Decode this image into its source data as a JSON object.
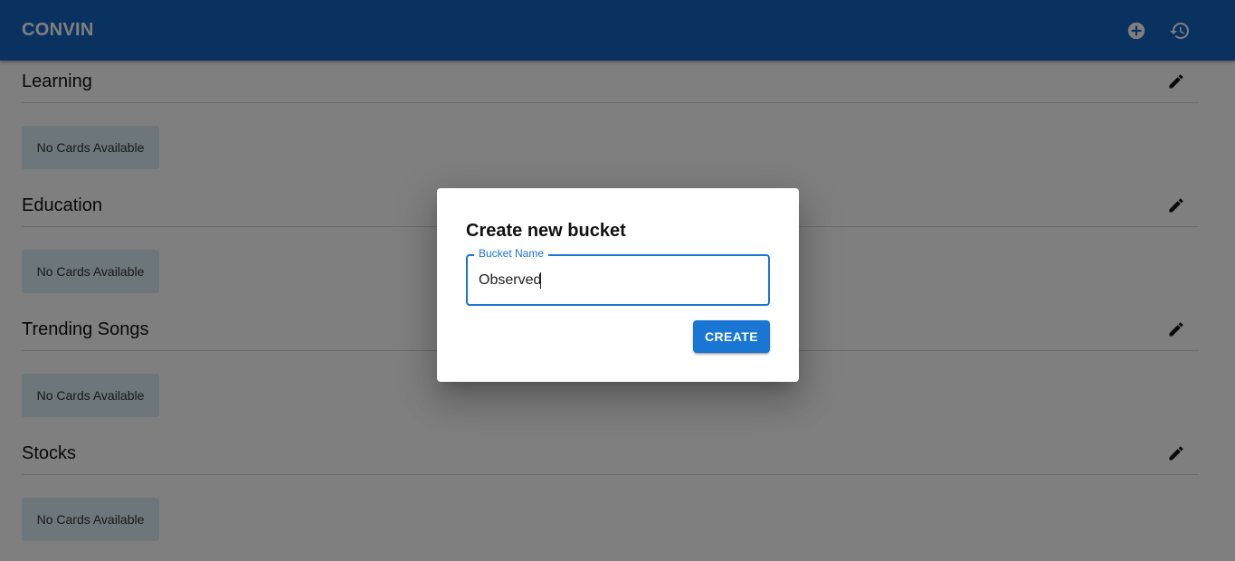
{
  "app": {
    "brand": "CONVIN",
    "actions": [
      {
        "icon": "add-circle-icon"
      },
      {
        "icon": "history-icon"
      }
    ]
  },
  "sections": [
    {
      "title": "Learning",
      "empty_text": "No Cards Available"
    },
    {
      "title": "Education",
      "empty_text": "No Cards Available"
    },
    {
      "title": "Trending Songs",
      "empty_text": "No Cards Available"
    },
    {
      "title": "Stocks",
      "empty_text": "No Cards Available"
    }
  ],
  "dialog": {
    "title": "Create new bucket",
    "field_label": "Bucket Name",
    "field_value": "Observed",
    "submit_label": "CREATE"
  },
  "colors": {
    "appbar": "#1565c0",
    "accent": "#1976d2",
    "empty_card": "#d9ecf6"
  }
}
